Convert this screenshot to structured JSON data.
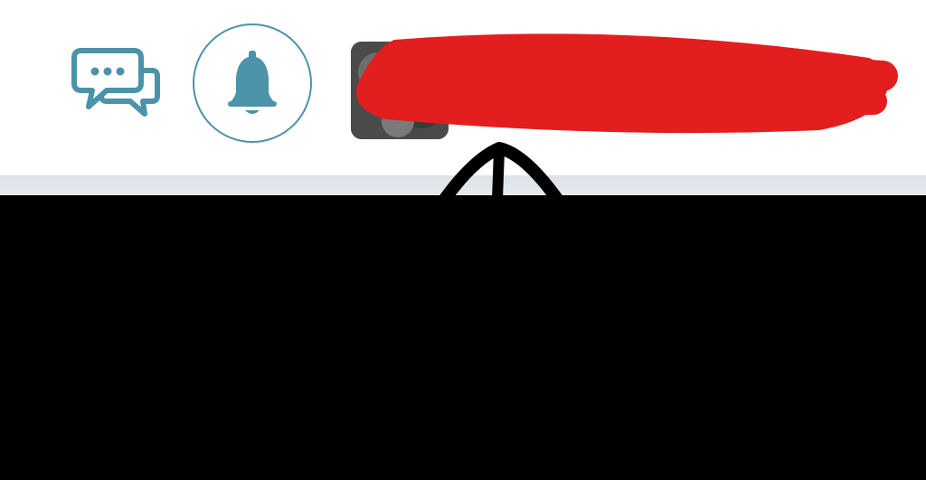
{
  "header": {
    "icons": {
      "messages": "chat-bubbles-icon",
      "notifications": "bell-icon",
      "user_menu_caret": "chevron-up-icon"
    },
    "colors": {
      "icon_accent": "#4b93a8",
      "redaction": "#e31e1e",
      "divider": "#e0e4e8",
      "content_background": "#000000"
    }
  }
}
